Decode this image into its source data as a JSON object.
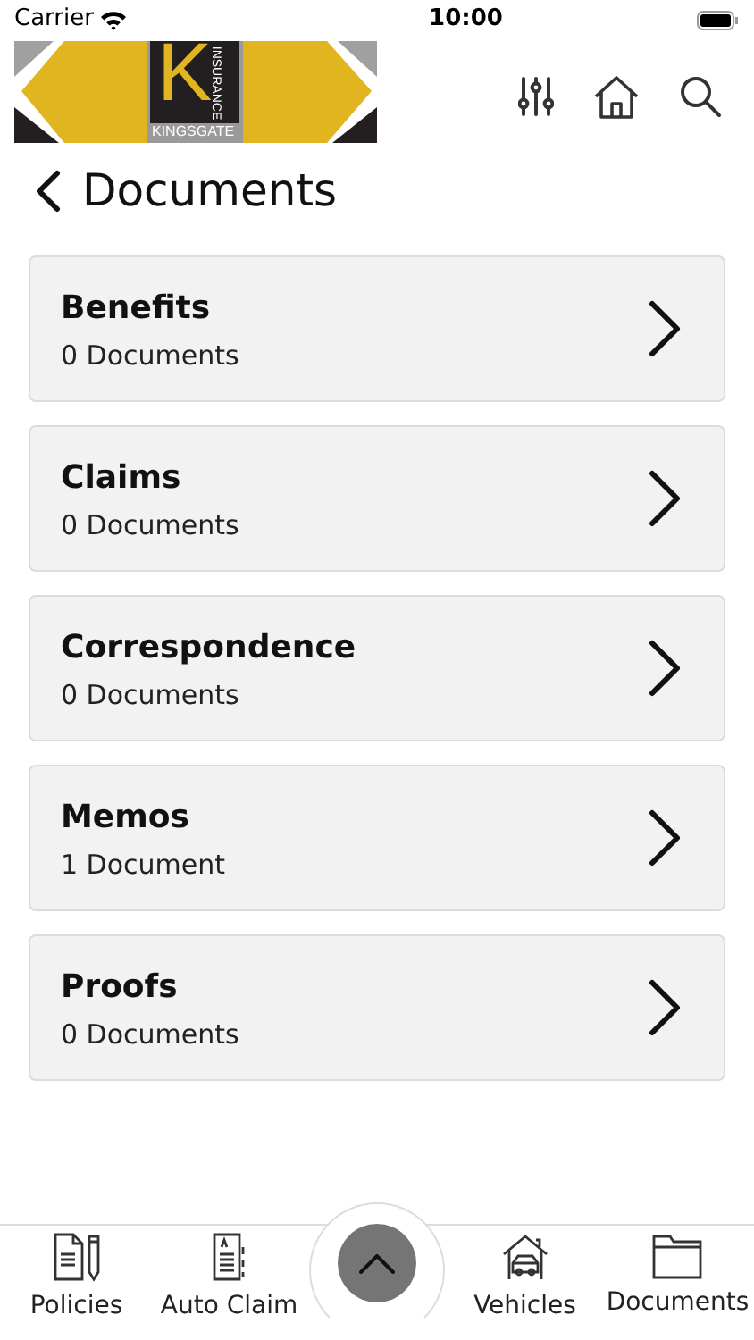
{
  "status_bar": {
    "carrier": "Carrier",
    "time": "10:00"
  },
  "logo": {
    "mark": "K",
    "name": "KINGSGATE",
    "tagline": "INSURANCE"
  },
  "page_title": "Documents",
  "categories": [
    {
      "title": "Benefits",
      "count": "0 Documents"
    },
    {
      "title": "Claims",
      "count": "0 Documents"
    },
    {
      "title": "Correspondence",
      "count": "0 Documents"
    },
    {
      "title": "Memos",
      "count": "1 Document"
    },
    {
      "title": "Proofs",
      "count": "0 Documents"
    }
  ],
  "tab_bar": [
    {
      "kind": "policies",
      "label": "Policies"
    },
    {
      "kind": "claim",
      "label": "Auto Claim"
    },
    {
      "kind": "center"
    },
    {
      "kind": "vehicles",
      "label": "Vehicles"
    },
    {
      "kind": "folder",
      "label": "Documents"
    }
  ]
}
